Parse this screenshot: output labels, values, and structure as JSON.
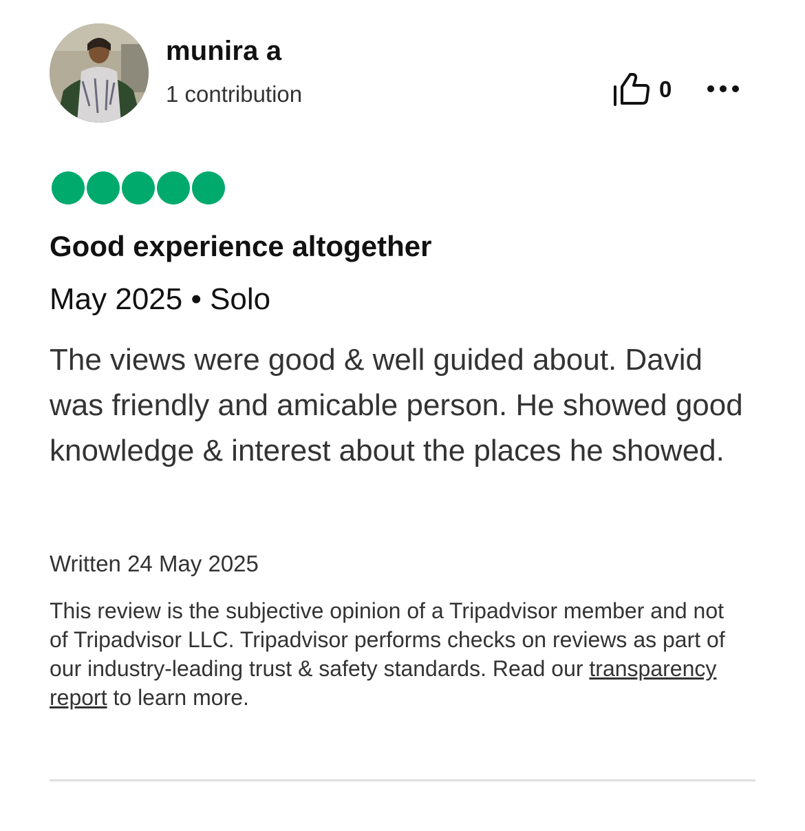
{
  "review": {
    "user": {
      "name": "munira a",
      "contributions": "1 contribution"
    },
    "helpful": {
      "count": "0",
      "icon": "thumbs-up-icon"
    },
    "more_icon": "more-dots-icon",
    "rating": {
      "value": 5,
      "max": 5,
      "color": "#00aa6c"
    },
    "title": "Good experience altogether",
    "trip": "May 2025 • Solo",
    "body": "The views were good & well guided about. David was friendly and amicable person. He showed good knowledge & interest about the places he showed.",
    "written": "Written 24 May 2025",
    "disclaimer": {
      "before": "This review is the subjective opinion of a Tripadvisor member and not of Tripadvisor LLC. Tripadvisor performs checks on reviews as part of our industry-leading trust & safety standards. Read our ",
      "link": "transparency report",
      "after": " to learn more."
    }
  }
}
